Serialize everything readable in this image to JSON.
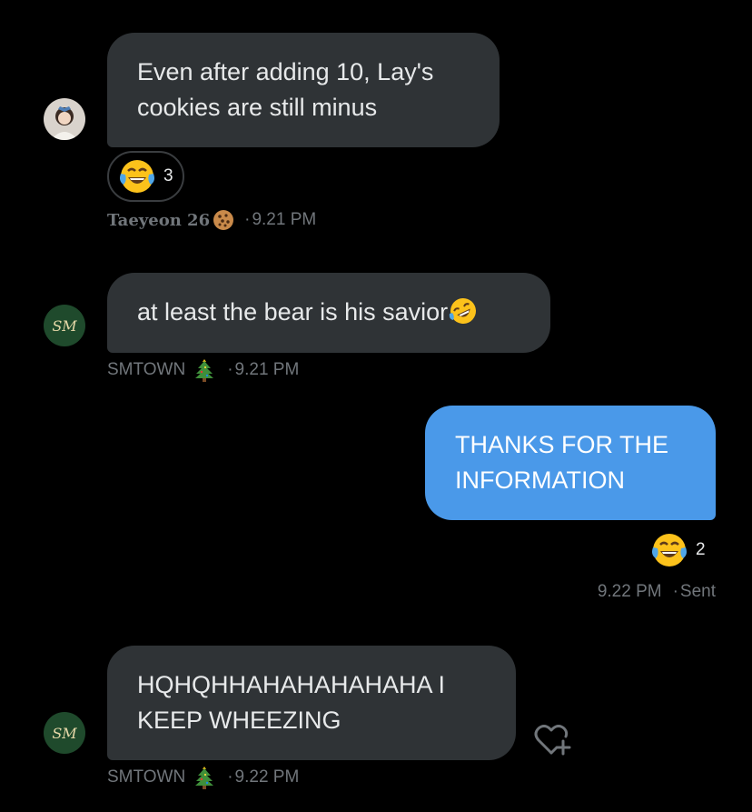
{
  "messages": [
    {
      "text": "Even after adding 10, Lay's cookies are still minus",
      "sender": "Taeyeon 26",
      "sender_emoji": "cookie-icon",
      "time": "9.21 PM",
      "reaction": {
        "emoji": "tears-of-joy-icon",
        "count": "3"
      }
    },
    {
      "text": "at least the bear is his savior",
      "sender": "SMTOWN",
      "sender_emoji": "christmas-tree-icon",
      "time": "9.21 PM"
    },
    {
      "text": "THANKS FOR THE INFORMATION",
      "time": "9.22 PM",
      "status": "Sent",
      "reaction": {
        "emoji": "tears-of-joy-icon",
        "count": "2"
      }
    },
    {
      "text": "HQHQHHAHAHAHAHAHA I KEEP WHEEZING",
      "sender": "SMTOWN",
      "sender_emoji": "christmas-tree-icon",
      "time": "9.22 PM"
    }
  ],
  "separator": "·",
  "colors": {
    "background": "#000000",
    "incoming_bubble": "#2f3336",
    "outgoing_bubble": "#4a99e9",
    "meta_text": "#71767b"
  }
}
